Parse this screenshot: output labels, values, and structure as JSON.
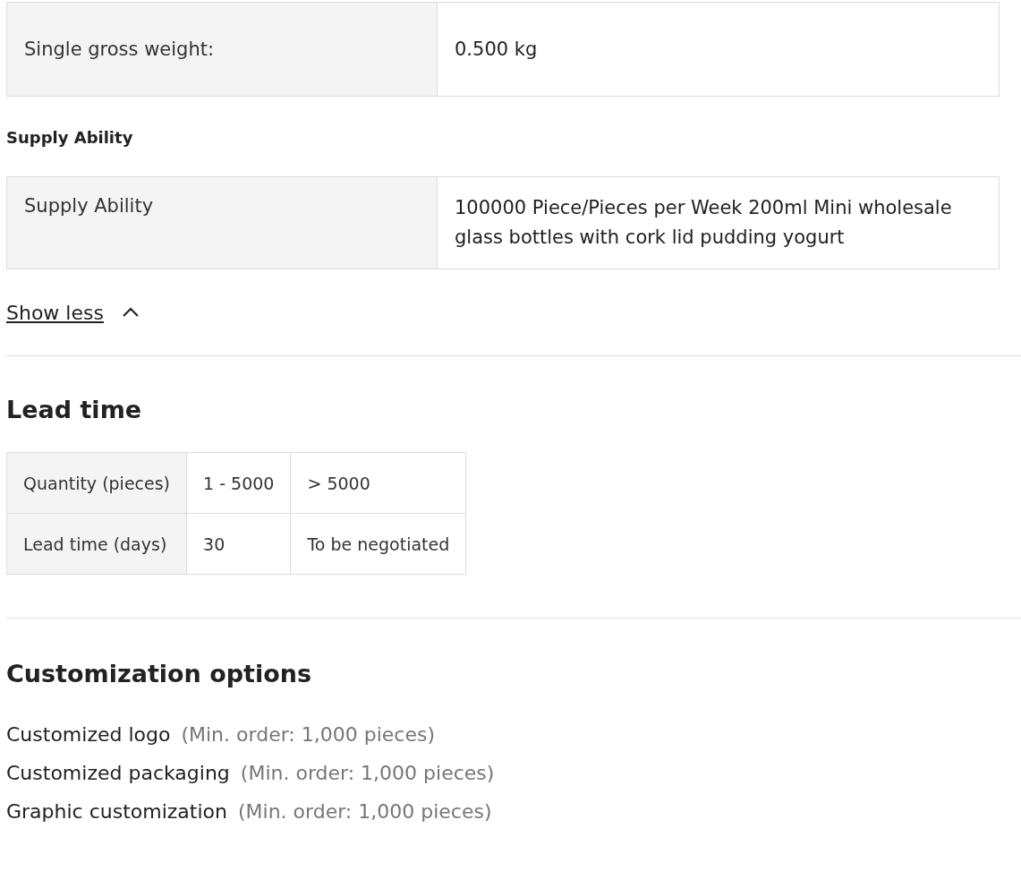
{
  "attributes_table": {
    "rows": [
      {
        "label": "Single gross weight:",
        "value": "0.500 kg"
      }
    ]
  },
  "supply_section": {
    "title": "Supply Ability",
    "rows": [
      {
        "label": "Supply Ability",
        "value": "100000 Piece/Pieces per Week 200ml Mini wholesale glass bottles with cork lid pudding yogurt"
      }
    ]
  },
  "toggle_link": {
    "label": "Show less",
    "expanded": true
  },
  "lead_time": {
    "title": "Lead time",
    "rows": [
      [
        "Quantity (pieces)",
        "1 - 5000",
        "> 5000"
      ],
      [
        "Lead time (days)",
        "30",
        "To be negotiated"
      ]
    ]
  },
  "customization": {
    "title": "Customization options",
    "items": [
      {
        "name": "Customized logo",
        "note": "(Min. order: 1,000 pieces)"
      },
      {
        "name": "Customized packaging",
        "note": "(Min. order: 1,000 pieces)"
      },
      {
        "name": "Graphic customization",
        "note": "(Min. order: 1,000 pieces)"
      }
    ]
  }
}
